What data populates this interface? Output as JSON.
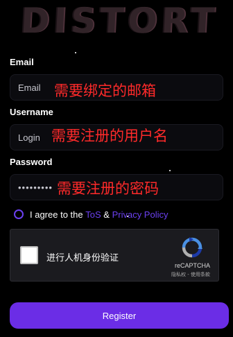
{
  "logo": "DISTORT",
  "email": {
    "label": "Email",
    "value": "Email",
    "annotation": "需要绑定的邮箱"
  },
  "username": {
    "label": "Username",
    "value": "Login",
    "annotation": "需要注册的用户名"
  },
  "password": {
    "label": "Password",
    "value": "•••••••••",
    "annotation": "需要注册的密码"
  },
  "agree": {
    "prefix": "I agree to the",
    "tos": "ToS",
    "amp": "&",
    "privacy": "Privacy Policy"
  },
  "captcha": {
    "text": "进行人机身份验证",
    "brand": "reCAPTCHA",
    "links": "隐私权 - 使用条款"
  },
  "register_label": "Register",
  "colors": {
    "accent": "#6b2de6",
    "link": "#6b40f0",
    "annotation": "#ff2a2a",
    "background": "#000000"
  }
}
